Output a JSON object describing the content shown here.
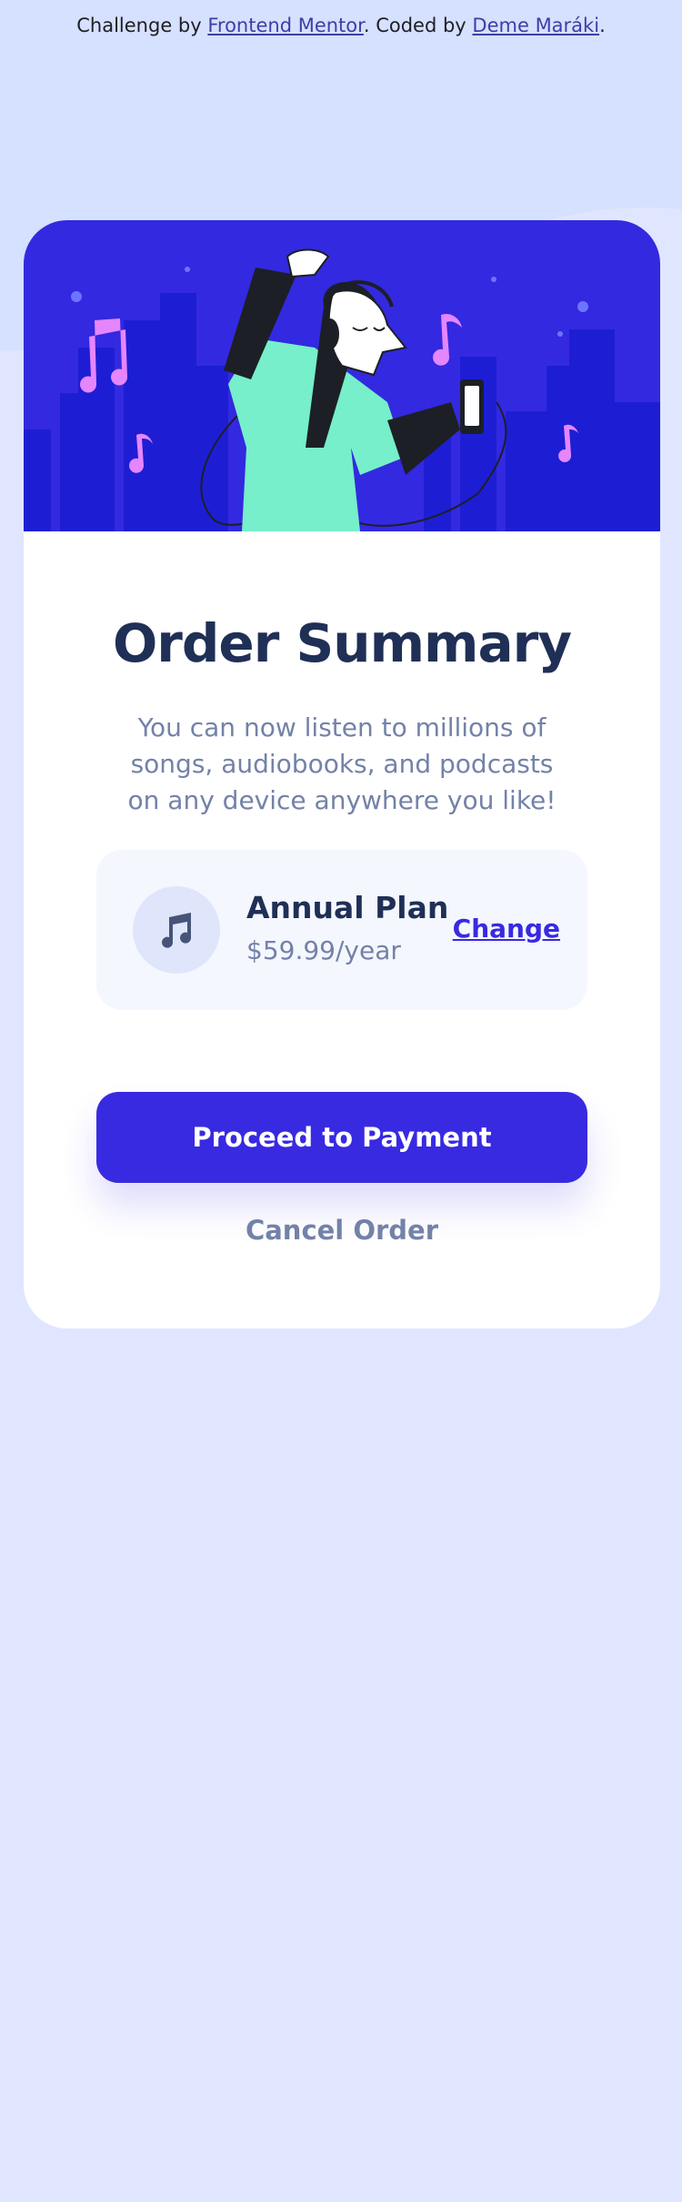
{
  "attribution": {
    "prefix": "Challenge by ",
    "link1": "Frontend Mentor",
    "middle": ". Coded by ",
    "link2": "Deme Maráki",
    "suffix": "."
  },
  "card": {
    "title": "Order Summary",
    "description": "You can now listen to millions of songs, audiobooks, and podcasts on any device anywhere you like!",
    "plan": {
      "icon": "music-note-icon",
      "name": "Annual Plan",
      "price": "$59.99/year",
      "change_label": "Change"
    },
    "primary_action": "Proceed to Payment",
    "secondary_action": "Cancel Order"
  },
  "colors": {
    "page_background": "#e0e6ff",
    "hero_background": "#3329e0",
    "accent": "#382ae1",
    "heading": "#1f2f56",
    "muted": "#7382a8"
  }
}
